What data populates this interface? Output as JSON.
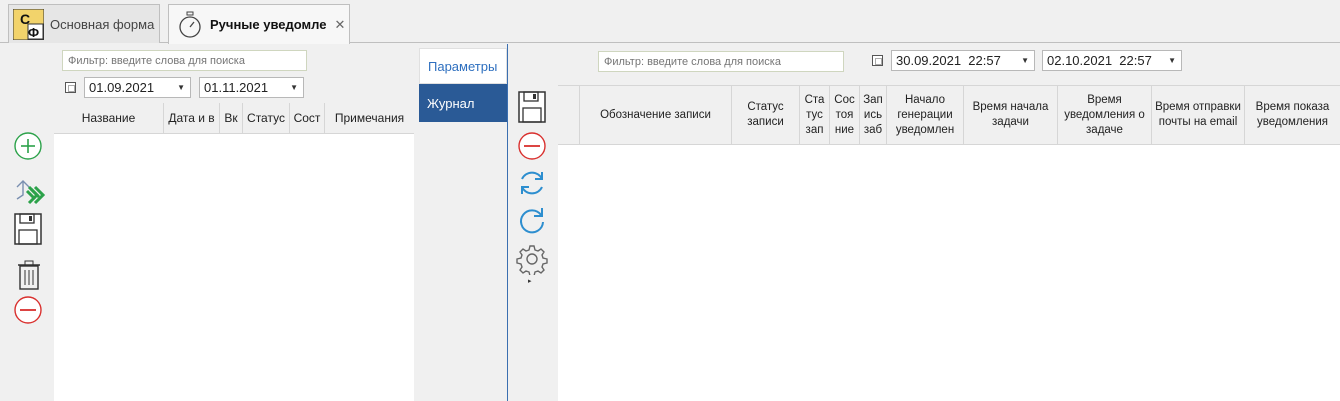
{
  "tabs": [
    {
      "label": "Основная форма",
      "logo": "СФ"
    },
    {
      "label": "Ручные уведомле",
      "close": "✕"
    }
  ],
  "left": {
    "filter_placeholder": "Фильтр: введите слова для поиска",
    "date_from": "01.09.2021",
    "date_to": "01.11.2021",
    "columns": [
      "Название",
      "Дата и в",
      "Вк",
      "Статус",
      "Сост",
      "Примечания"
    ]
  },
  "side_tabs": [
    "Параметры",
    "Журнал"
  ],
  "right": {
    "filter_placeholder": "Фильтр: введите слова для поиска",
    "date_from": "30.09.2021  22:57",
    "date_to": "02.10.2021  22:57",
    "columns": [
      "Обозначение записи",
      "Статус записи",
      "Ста тус зап",
      "Сос тоя ние",
      "Зап ись заб",
      "Начало генерации уведомлен",
      "Время начала задачи",
      "Время уведомления о задаче",
      "Время отправки почты на email",
      "Время показа уведомления"
    ]
  },
  "icons": {
    "left_toolbar": [
      "add-icon",
      "transfer-icon",
      "save-icon",
      "trash-icon",
      "remove-icon"
    ],
    "right_toolbar": [
      "save-icon",
      "remove-icon",
      "refresh-icon",
      "redo-icon",
      "gear-icon"
    ]
  },
  "colors": {
    "accent": "#2a5a96",
    "add": "#2ca24a",
    "remove": "#d9302e",
    "refresh": "#2d8ecf"
  }
}
